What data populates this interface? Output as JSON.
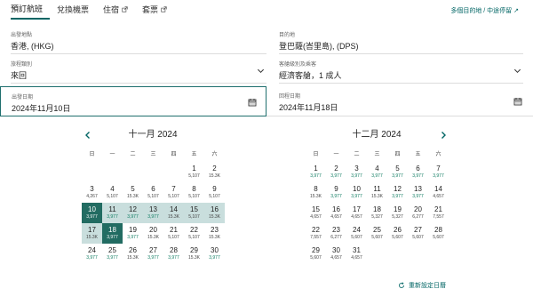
{
  "tabs": [
    {
      "label": "預訂航班",
      "active": true,
      "external": false
    },
    {
      "label": "兌換機票",
      "active": false,
      "external": false
    },
    {
      "label": "住宿",
      "active": false,
      "external": true
    },
    {
      "label": "套票",
      "active": false,
      "external": true
    }
  ],
  "top_link": "多個目的地 / 中途停留 ↗",
  "fields": {
    "from": {
      "label": "出發地點",
      "value": "香港, (HKG)"
    },
    "to": {
      "label": "目的地",
      "value": "登巴薩(峇里島), (DPS)"
    },
    "trip": {
      "label": "旅程類別",
      "value": "來回"
    },
    "cabin": {
      "label": "客艙級別及乘客",
      "value": "經濟客艙，1 成人"
    },
    "depart": {
      "label": "出發日期",
      "value": "2024年11月10日"
    },
    "return": {
      "label": "回程日期",
      "value": "2024年11月18日"
    }
  },
  "weekdays": [
    "日",
    "一",
    "二",
    "三",
    "四",
    "五",
    "六"
  ],
  "calendars": [
    {
      "title": "十一月 2024",
      "lead_blanks": 5,
      "days": [
        {
          "d": "1",
          "p": "5,107"
        },
        {
          "d": "2",
          "p": "15.3K"
        },
        {
          "d": "3",
          "p": "4,267"
        },
        {
          "d": "4",
          "p": "5,107"
        },
        {
          "d": "5",
          "p": "15.3K"
        },
        {
          "d": "6",
          "p": "5,107"
        },
        {
          "d": "7",
          "p": "5,107"
        },
        {
          "d": "8",
          "p": "5,107"
        },
        {
          "d": "9",
          "p": "5,107"
        },
        {
          "d": "10",
          "p": "3,977"
        },
        {
          "d": "11",
          "p": "3,977"
        },
        {
          "d": "12",
          "p": "3,977"
        },
        {
          "d": "13",
          "p": "3,977"
        },
        {
          "d": "14",
          "p": "15.3K"
        },
        {
          "d": "15",
          "p": "5,107"
        },
        {
          "d": "16",
          "p": "15.3K"
        },
        {
          "d": "17",
          "p": "15.3K"
        },
        {
          "d": "18",
          "p": "3,977"
        },
        {
          "d": "19",
          "p": "3,977"
        },
        {
          "d": "20",
          "p": "15.3K"
        },
        {
          "d": "21",
          "p": "5,107"
        },
        {
          "d": "22",
          "p": "5,107"
        },
        {
          "d": "23",
          "p": "15.3K"
        },
        {
          "d": "24",
          "p": "3,977"
        },
        {
          "d": "25",
          "p": "3,977"
        },
        {
          "d": "26",
          "p": "15.3K"
        },
        {
          "d": "27",
          "p": "3,977"
        },
        {
          "d": "28",
          "p": "3,977"
        },
        {
          "d": "29",
          "p": "15.3K"
        },
        {
          "d": "30",
          "p": "3,977"
        }
      ]
    },
    {
      "title": "十二月 2024",
      "lead_blanks": 0,
      "days": [
        {
          "d": "1",
          "p": "3,977"
        },
        {
          "d": "2",
          "p": "3,977"
        },
        {
          "d": "3",
          "p": "3,977"
        },
        {
          "d": "4",
          "p": "3,977"
        },
        {
          "d": "5",
          "p": "3,977"
        },
        {
          "d": "6",
          "p": "3,977"
        },
        {
          "d": "7",
          "p": "3,977"
        },
        {
          "d": "8",
          "p": "15.3K"
        },
        {
          "d": "9",
          "p": "3,977"
        },
        {
          "d": "10",
          "p": "3,977"
        },
        {
          "d": "11",
          "p": "15.3K"
        },
        {
          "d": "12",
          "p": "3,977"
        },
        {
          "d": "13",
          "p": "3,977"
        },
        {
          "d": "14",
          "p": "4,657"
        },
        {
          "d": "15",
          "p": "4,657"
        },
        {
          "d": "16",
          "p": "4,657"
        },
        {
          "d": "17",
          "p": "4,657"
        },
        {
          "d": "18",
          "p": "5,327"
        },
        {
          "d": "19",
          "p": "5,327"
        },
        {
          "d": "20",
          "p": "6,277"
        },
        {
          "d": "21",
          "p": "7,557"
        },
        {
          "d": "22",
          "p": "7,557"
        },
        {
          "d": "23",
          "p": "6,277"
        },
        {
          "d": "24",
          "p": "5,607"
        },
        {
          "d": "25",
          "p": "5,607"
        },
        {
          "d": "26",
          "p": "5,607"
        },
        {
          "d": "27",
          "p": "5,607"
        },
        {
          "d": "28",
          "p": "5,607"
        },
        {
          "d": "29",
          "p": "5,607"
        },
        {
          "d": "30",
          "p": "4,657"
        },
        {
          "d": "31",
          "p": "4,657"
        }
      ]
    }
  ],
  "selection": {
    "start": "2024年11月10日",
    "end": "2024年11月18日"
  },
  "reset_label": "重新設定日曆",
  "colors": {
    "accent": "#006564",
    "selected": "#226c62",
    "range": "#c9dedd",
    "low_price": "#0b7a5f"
  }
}
